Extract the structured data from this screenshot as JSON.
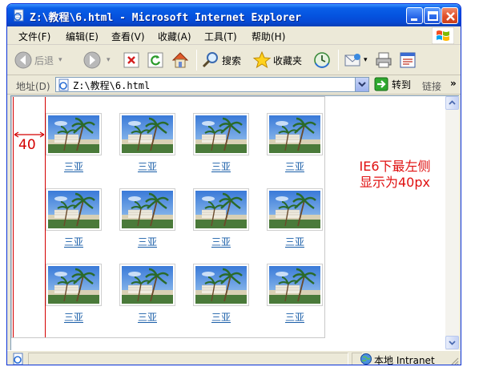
{
  "window": {
    "title": "Z:\\教程\\6.html - Microsoft Internet Explorer"
  },
  "menu": {
    "items": [
      "文件(F)",
      "编辑(E)",
      "查看(V)",
      "收藏(A)",
      "工具(T)",
      "帮助(H)"
    ]
  },
  "toolbar": {
    "back_label": "后退",
    "search_label": "搜索",
    "favorites_label": "收藏夹"
  },
  "address": {
    "label": "地址(D)",
    "url": "Z:\\教程\\6.html",
    "go_label": "转到",
    "links_label": "链接",
    "links_chevron": "»"
  },
  "content": {
    "measure_label": "40",
    "note_lines": [
      "IE6下最左侧",
      "显示为40px"
    ],
    "gallery": [
      "三亚",
      "三亚",
      "三亚",
      "三亚",
      "三亚",
      "三亚",
      "三亚",
      "三亚",
      "三亚",
      "三亚",
      "三亚",
      "三亚"
    ]
  },
  "status": {
    "zone_label": "本地 Intranet"
  },
  "colors": {
    "titlebar": "#0554e0",
    "accent_red": "#d40000",
    "link_blue": "#1a5ea8"
  }
}
